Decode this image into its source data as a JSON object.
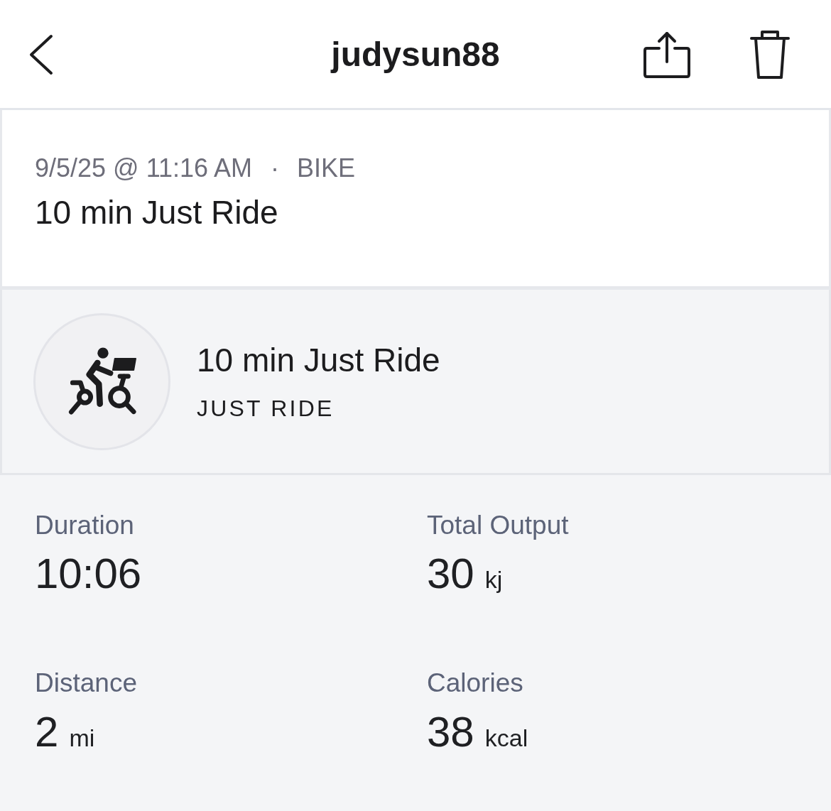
{
  "header": {
    "title": "judysun88"
  },
  "workout": {
    "date": "9/5/25 @ 11:16 AM",
    "separator": "·",
    "category": "BIKE",
    "title": "10 min Just Ride"
  },
  "class": {
    "title": "10 min Just Ride",
    "type": "JUST RIDE"
  },
  "stats": [
    {
      "label": "Duration",
      "value": "10:06"
    },
    {
      "label": "Total Output",
      "value": "30",
      "unit": "kj"
    },
    {
      "label": "Distance",
      "value": "2",
      "unit": "mi"
    },
    {
      "label": "Calories",
      "value": "38",
      "unit": "kcal"
    }
  ]
}
